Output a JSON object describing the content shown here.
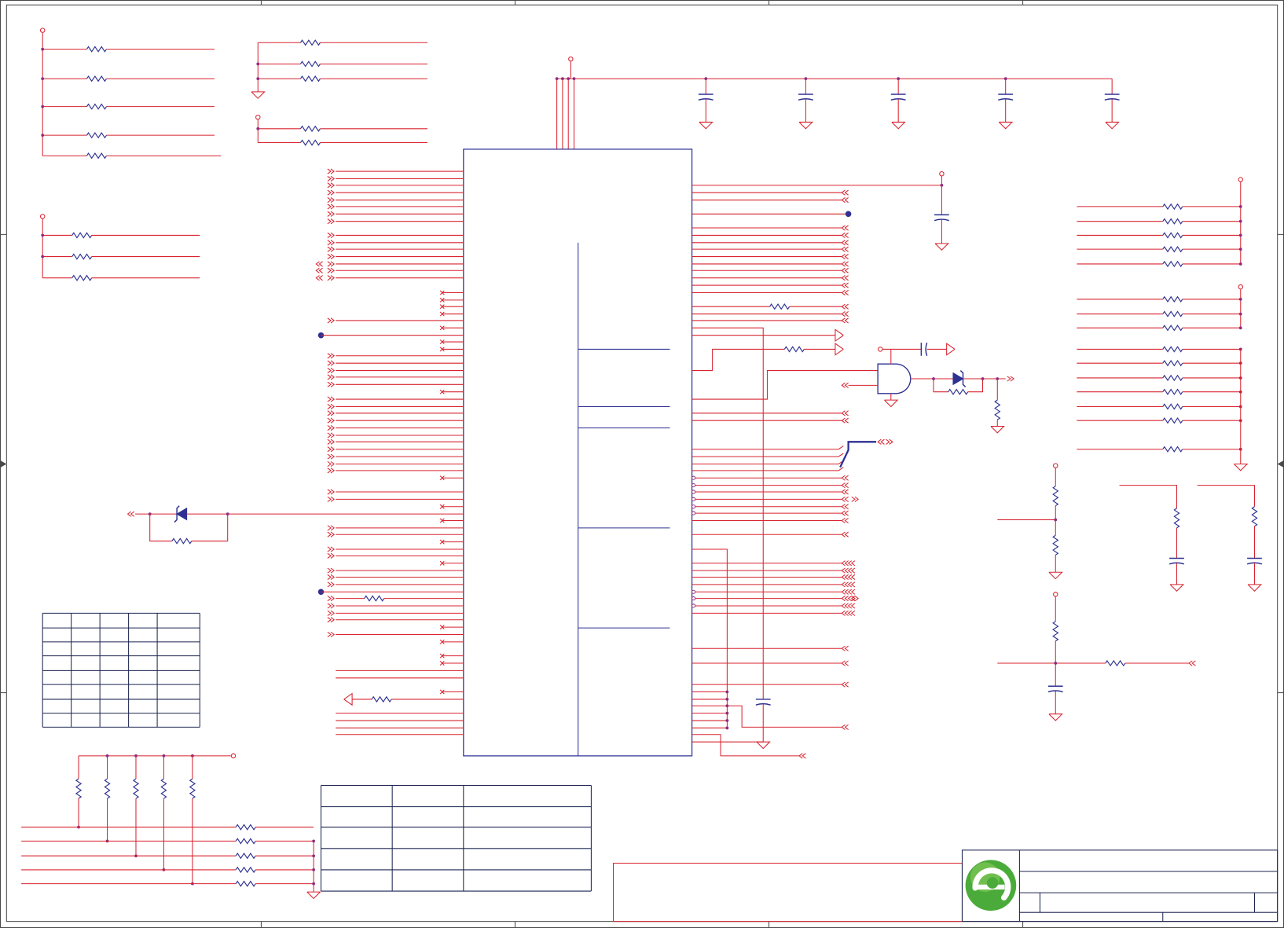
{
  "colors": {
    "background": "#ffffff",
    "wire": "#d8232f",
    "component": "#2e3192",
    "junction": "#8e2a7e",
    "table": "#1c2550",
    "frame": "#4a4a4a",
    "logo": "#4bab3a",
    "logo_highlight": "#8fd05e"
  },
  "icons": {
    "logo": "company-logo-icon"
  }
}
